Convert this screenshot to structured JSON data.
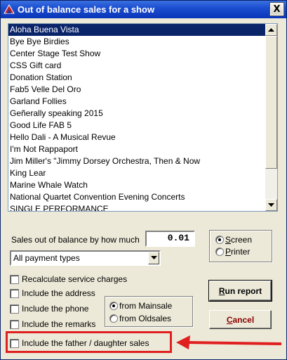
{
  "window": {
    "title": "Out of balance sales for a show",
    "close_label": "X"
  },
  "shows_list": {
    "selected_index": 0,
    "items": [
      "Aloha Buena Vista",
      "Bye Bye Birdies",
      "Center Stage Test Show",
      "CSS Gift card",
      "Donation Station",
      "Fab5 Velle Del Oro",
      "Garland Follies",
      "Geñerally speaking 2015",
      "Good Life FAB 5",
      "Hello Dali - A Musical Revue",
      "I'm Not Rappaport",
      "Jim Miller's \"Jimmy Dorsey Orchestra, Then & Now",
      "King Lear",
      "Marine Whale Watch",
      "National Quartet Convention Evening Concerts",
      "SINGLE PERFORMANCE"
    ]
  },
  "amount": {
    "label": "Sales out of balance by how much",
    "value": "0.01"
  },
  "payment_type": {
    "value": "All payment types"
  },
  "output": {
    "screen_label": "Screen",
    "printer_label": "Printer",
    "selected": "Screen"
  },
  "options": {
    "recalculate": "Recalculate service charges",
    "address": "Include the address",
    "phone": "Include the phone",
    "remarks": "Include the remarks",
    "father_daughter": "Include the father / daughter sales"
  },
  "source": {
    "mainsale_label": "from Mainsale",
    "oldsales_label": "from Oldsales",
    "selected": "from Mainsale"
  },
  "buttons": {
    "run_report": "Run report",
    "cancel": "Cancel"
  },
  "colors": {
    "titlebar": "#0a35b8",
    "selection": "#0a246a",
    "annotation": "#e02020",
    "cancel_text": "#8b0000"
  }
}
